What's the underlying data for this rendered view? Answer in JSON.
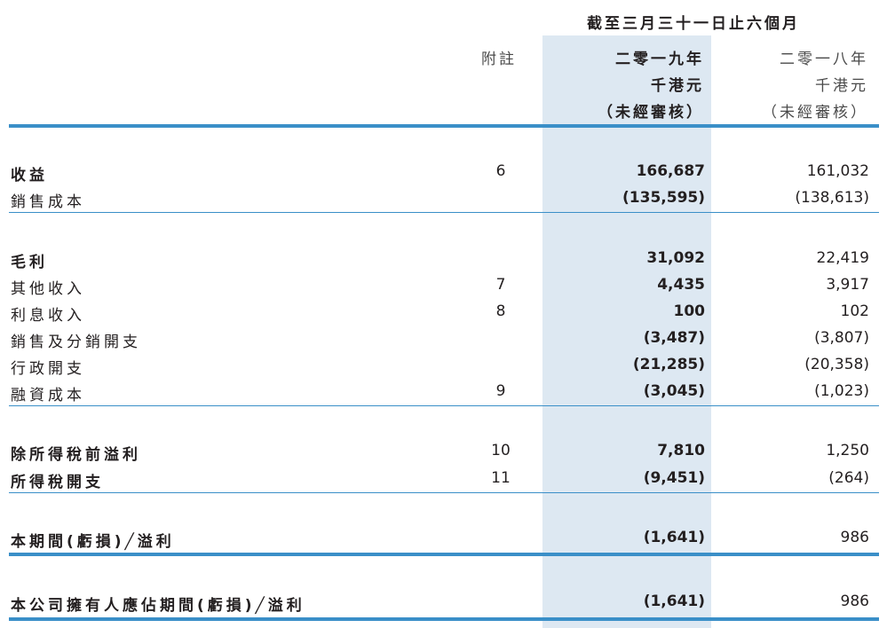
{
  "header": {
    "period": "截至三月三十一日止六個月",
    "note_col": "附註",
    "current_year": "二零一九年",
    "prior_year": "二零一八年",
    "currency": "千港元",
    "unaudited": "（未經審核）"
  },
  "rows": [
    {
      "label": "收益",
      "note": "6",
      "current": "166,687",
      "prior": "161,032",
      "bold": true
    },
    {
      "label": "銷售成本",
      "note": "",
      "current": "(135,595)",
      "prior": "(138,613)",
      "bold": false
    },
    {
      "label": "毛利",
      "note": "",
      "current": "31,092",
      "prior": "22,419",
      "bold": true
    },
    {
      "label": "其他收入",
      "note": "7",
      "current": "4,435",
      "prior": "3,917",
      "bold": false
    },
    {
      "label": "利息收入",
      "note": "8",
      "current": "100",
      "prior": "102",
      "bold": false
    },
    {
      "label": "銷售及分銷開支",
      "note": "",
      "current": "(3,487)",
      "prior": "(3,807)",
      "bold": false
    },
    {
      "label": "行政開支",
      "note": "",
      "current": "(21,285)",
      "prior": "(20,358)",
      "bold": false
    },
    {
      "label": "融資成本",
      "note": "9",
      "current": "(3,045)",
      "prior": "(1,023)",
      "bold": false
    },
    {
      "label": "除所得稅前溢利",
      "note": "10",
      "current": "7,810",
      "prior": "1,250",
      "bold": true
    },
    {
      "label": "所得稅開支",
      "note": "11",
      "current": "(9,451)",
      "prior": "(264)",
      "bold": true
    },
    {
      "label": "本期間(虧損)╱溢利",
      "note": "",
      "current": "(1,641)",
      "prior": "986",
      "bold": true
    },
    {
      "label": "本公司擁有人應佔期間(虧損)╱溢利",
      "note": "",
      "current": "(1,641)",
      "prior": "986",
      "bold": true
    }
  ],
  "colors": {
    "accent": "#3a8fc8",
    "shade": "#dde8f2"
  }
}
